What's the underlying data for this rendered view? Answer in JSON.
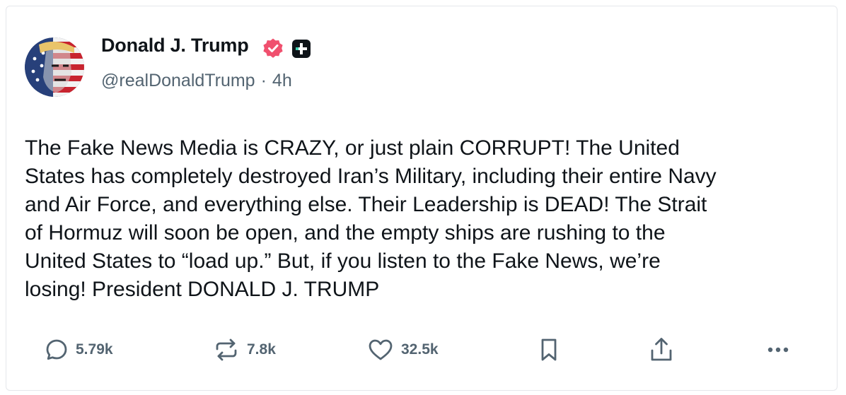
{
  "author": {
    "display_name": "Donald J. Trump",
    "handle": "@realDonaldTrump",
    "separator": "·",
    "time": "4h"
  },
  "post": {
    "text": "The Fake News Media is CRAZY, or just plain CORRUPT! The United\nStates has completely destroyed Iran’s Military, including their entire Navy\nand Air Force, and everything else. Their Leadership is DEAD! The Strait\nof Hormuz will soon be open, and the empty ships are rushing to the\nUnited States to “load up.” But, if you listen to the Fake News, we’re\nlosing! President DONALD J. TRUMP"
  },
  "actions": {
    "reply": {
      "icon": "reply-icon",
      "count": "5.79k"
    },
    "repost": {
      "icon": "repost-icon",
      "count": "7.8k"
    },
    "like": {
      "icon": "heart-icon",
      "count": "32.5k"
    },
    "bookmark": {
      "icon": "bookmark-icon"
    },
    "share": {
      "icon": "share-icon"
    },
    "more": {
      "icon": "more-icon"
    }
  },
  "colors": {
    "text": "#0f1419",
    "muted": "#536471",
    "verified_badge": "#f0506e",
    "border": "#e5e7eb"
  }
}
